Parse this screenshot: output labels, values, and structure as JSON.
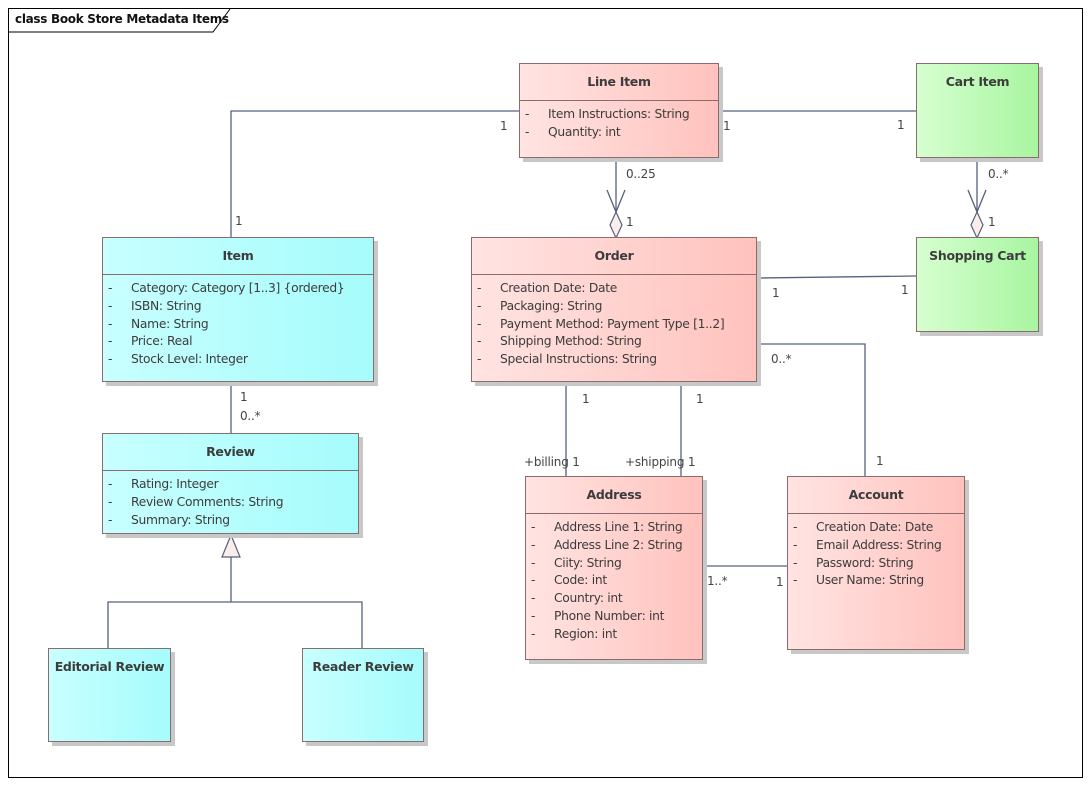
{
  "diagram": {
    "title": "class Book Store Metadata Items",
    "colors": {
      "line": "#54607e",
      "pink_fill": "#ffc2bd",
      "cyan_fill": "#a6fcfc",
      "green_fill": "#a8f5a0",
      "border": "#8b6b6b"
    }
  },
  "classes": {
    "line_item": {
      "name": "Line Item",
      "attributes": [
        {
          "vis": "-",
          "text": "Item Instructions: String"
        },
        {
          "vis": "-",
          "text": "Quantity: int"
        }
      ]
    },
    "cart_item": {
      "name": "Cart Item",
      "attributes": []
    },
    "item": {
      "name": "Item",
      "attributes": [
        {
          "vis": "-",
          "text": "Category: Category [1..3] {ordered}"
        },
        {
          "vis": "-",
          "text": "ISBN: String"
        },
        {
          "vis": "-",
          "text": "Name: String"
        },
        {
          "vis": "-",
          "text": "Price: Real"
        },
        {
          "vis": "-",
          "text": "Stock Level: Integer"
        }
      ]
    },
    "order": {
      "name": "Order",
      "attributes": [
        {
          "vis": "-",
          "text": "Creation Date: Date"
        },
        {
          "vis": "-",
          "text": "Packaging: String"
        },
        {
          "vis": "-",
          "text": "Payment Method: Payment Type [1..2]"
        },
        {
          "vis": "-",
          "text": "Shipping Method: String"
        },
        {
          "vis": "-",
          "text": "Special Instructions: String"
        }
      ]
    },
    "shopping_cart": {
      "name": "Shopping Cart",
      "attributes": []
    },
    "review": {
      "name": "Review",
      "attributes": [
        {
          "vis": "-",
          "text": "Rating: Integer"
        },
        {
          "vis": "-",
          "text": "Review Comments: String"
        },
        {
          "vis": "-",
          "text": "Summary: String"
        }
      ]
    },
    "address": {
      "name": "Address",
      "attributes": [
        {
          "vis": "-",
          "text": "Address Line 1: String"
        },
        {
          "vis": "-",
          "text": "Address Line 2: String"
        },
        {
          "vis": "-",
          "text": "Ciity: String"
        },
        {
          "vis": "-",
          "text": "Code: int"
        },
        {
          "vis": "-",
          "text": "Country: int"
        },
        {
          "vis": "-",
          "text": "Phone Number: int"
        },
        {
          "vis": "-",
          "text": "Region: int"
        }
      ]
    },
    "account": {
      "name": "Account",
      "attributes": [
        {
          "vis": "-",
          "text": "Creation Date: Date"
        },
        {
          "vis": "-",
          "text": "Email Address: String"
        },
        {
          "vis": "-",
          "text": "Password: String"
        },
        {
          "vis": "-",
          "text": "User Name: String"
        }
      ]
    },
    "editorial_review": {
      "name": "Editorial Review",
      "attributes": []
    },
    "reader_review": {
      "name": "Reader Review",
      "attributes": []
    }
  },
  "associations": {
    "lineitem_item": {
      "source_mult": "1",
      "target_mult": "1"
    },
    "lineitem_cartitem": {
      "source_mult": "1",
      "target_mult": "1"
    },
    "lineitem_order": {
      "source_mult": "0..25",
      "target_mult": "1"
    },
    "cartitem_shoppingcart": {
      "source_mult": "0..*",
      "target_mult": "1"
    },
    "order_shoppingcart": {
      "source_mult": "1",
      "target_mult": "1"
    },
    "order_account": {
      "source_mult": "0..*",
      "target_mult": "1"
    },
    "item_review": {
      "source_mult": "1",
      "target_mult": "0..*"
    },
    "order_address_billing": {
      "source_mult": "1",
      "target_mult": "+billing 1"
    },
    "order_address_shipping": {
      "source_mult": "1",
      "target_mult": "+shipping 1"
    },
    "address_account": {
      "source_mult": "1..*",
      "target_mult": "1"
    }
  }
}
